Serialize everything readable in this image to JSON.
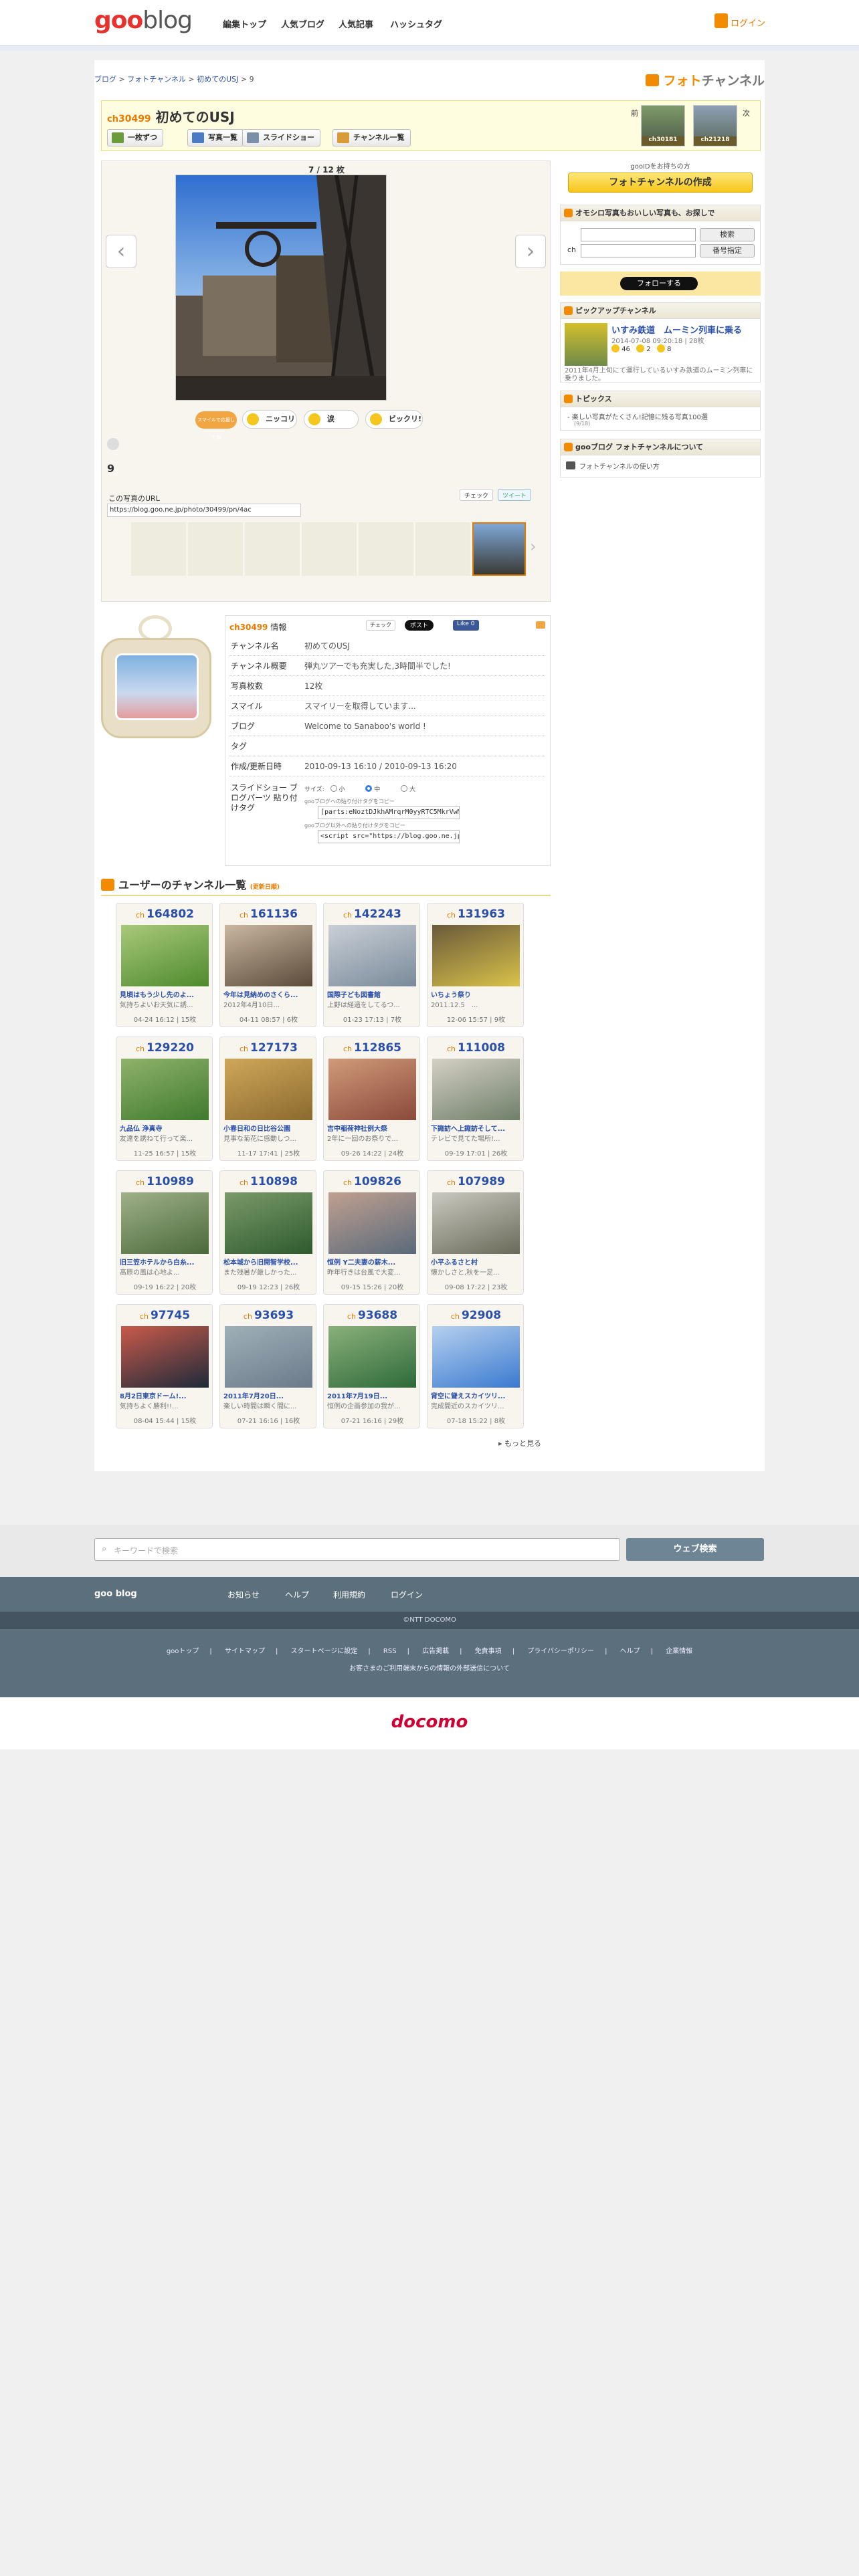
{
  "header": {
    "logo_goo": "goo",
    "logo_blog": "blog",
    "nav": [
      "編集トップ",
      "人気ブログ",
      "人気記事",
      "ハッシュタグ"
    ],
    "login": "ログイン"
  },
  "breadcrumb": {
    "items": [
      "ブログ",
      "フォトチャンネル",
      "初めてのUSJ"
    ],
    "current": "9"
  },
  "photo_channel_logo": {
    "a": "フォト",
    "b": "チャンネル"
  },
  "channel": {
    "prefix": "ch",
    "number": "30499",
    "title": "初めてのUSJ"
  },
  "toolbar": {
    "single": "一枚ずつ",
    "list": "写真一覧",
    "slideshow": "スライドショー",
    "channels": "チャンネル一覧"
  },
  "nav_neighbors": {
    "prev": "前",
    "next": "次",
    "prev_ch": "ch30181",
    "next_ch": "ch21218"
  },
  "viewer": {
    "counter": "7 / 12 枚",
    "caption": "9",
    "url_label": "この写真のURL",
    "url": "https://blog.goo.ne.jp/photo/30499/pn/4ac",
    "reactions": [
      "ニッコリ",
      "涙",
      "ビックリ!"
    ],
    "reaction_hint": "スマイルで応援してね",
    "check": "チェック",
    "tweet": "ツイート"
  },
  "sidebar": {
    "gooid": "gooIDをお持ちの方",
    "create": "フォトチャンネルの作成",
    "search_title": "オモシロ写真もおいしい写真も、お探しで",
    "search_btn": "検索",
    "ch_label": "ch",
    "number_btn": "番号指定",
    "follow": "フォローする",
    "pickup_title": "ピックアップチャンネル",
    "pickup_name": "いすみ鉄道　ムーミン列車に乗る",
    "pickup_date": "2014-07-08 09:20:18 | 28枚",
    "pickup_counts": [
      "46",
      "2",
      "8"
    ],
    "pickup_desc": "2011年4月上旬にて運行しているいすみ鉄道のムーミン列車に乗りました。",
    "topics_title": "トピックス",
    "topics_item": "楽しい写真がたくさん!記憶に残る写真100選",
    "topics_sub": "(9/18)",
    "about_title": "gooブログ フォトチャンネルについて",
    "about_item": "フォトチャンネルの使い方"
  },
  "info": {
    "heading_suffix": "情報",
    "check": "チェック",
    "post": "ポスト",
    "like": "Like 0",
    "rows": [
      {
        "k": "チャンネル名",
        "v": "初めてのUSJ"
      },
      {
        "k": "チャンネル概要",
        "v": "弾丸ツアーでも充実した,3時間半でした!"
      },
      {
        "k": "写真枚数",
        "v": "12枚"
      },
      {
        "k": "スマイル",
        "v": "スマイリーを取得しています..."
      },
      {
        "k": "ブログ",
        "v": "Welcome to Sanaboo's world !"
      },
      {
        "k": "タグ",
        "v": ""
      },
      {
        "k": "作成/更新日時",
        "v": "2010-09-13 16:10 / 2010-09-13 16:20"
      }
    ],
    "slideshow_label": "スライドショー ブログパーツ 貼り付けタグ",
    "size_label": "サイズ:",
    "sizes": [
      "小",
      "中",
      "大"
    ],
    "goo_tag_label": "gooブログへの貼り付けタグをコピー",
    "goo_tag": "[parts:eNoztDJkhAMrqrM0yyRTC5MkrVwMT",
    "ext_tag_label": "gooブログ以外への貼り付けタグをコピー",
    "ext_tag": "<script src=\"https://blog.goo.ne.jp/swf/pic"
  },
  "user_channels": {
    "title": "ユーザーのチャンネル一覧",
    "sub": "(更新日順)",
    "more": "もっと見る",
    "cards": [
      {
        "n": "164802",
        "t": "見頃はもう少し先のよ...",
        "d": "気持ちよいお天気に誘...",
        "m": "04-24 16:12 | 15枚"
      },
      {
        "n": "161136",
        "t": "今年は見納めのさくら...",
        "d": "2012年4月10日...",
        "m": "04-11 08:57 | 6枚"
      },
      {
        "n": "142243",
        "t": "国際子ども図書館",
        "d": "上野は経過をしてるつ...",
        "m": "01-23 17:13 | 7枚"
      },
      {
        "n": "131963",
        "t": "いちょう祭り",
        "d": "2011.12.5　...",
        "m": "12-06 15:57 | 9枚"
      },
      {
        "n": "129220",
        "t": "九品仏 浄真寺",
        "d": "友達を誘ねて行って楽...",
        "m": "11-25 16:57 | 15枚"
      },
      {
        "n": "127173",
        "t": "小春日和の日比谷公園",
        "d": "見事な菊花に感動しつ...",
        "m": "11-17 17:41 | 25枚"
      },
      {
        "n": "112865",
        "t": "吉中稲荷神社例大祭",
        "d": "2年に一回のお祭りで...",
        "m": "09-26 14:22 | 24枚"
      },
      {
        "n": "111008",
        "t": "下諏訪へ上諏訪そして...",
        "d": "テレビで見てた場所!...",
        "m": "09-19 17:01 | 26枚"
      },
      {
        "n": "110989",
        "t": "旧三笠ホテルから白糸...",
        "d": "高原の風は心地よ...",
        "m": "09-19 16:22 | 20枚"
      },
      {
        "n": "110898",
        "t": "松本城から旧開智学校...",
        "d": "また残暑が厳しかった...",
        "m": "09-19 12:23 | 26枚"
      },
      {
        "n": "109826",
        "t": "恒例 Y二夫妻の薪木...",
        "d": "昨年行きは台風で大変...",
        "m": "09-15 15:26 | 20枚"
      },
      {
        "n": "107989",
        "t": "小平ふるさと村",
        "d": "懐かしさと,秋を一足...",
        "m": "09-08 17:22 | 23枚"
      },
      {
        "n": "97745",
        "t": "8月2日東京ドーム!...",
        "d": "気持ちよく勝利!!...",
        "m": "08-04 15:44 | 15枚"
      },
      {
        "n": "93693",
        "t": "2011年7月20日...",
        "d": "楽しい時間は瞬く間に...",
        "m": "07-21 16:16 | 16枚"
      },
      {
        "n": "93688",
        "t": "2011年7月19日...",
        "d": "恒例の企画参加の我が...",
        "m": "07-21 16:16 | 29枚"
      },
      {
        "n": "92908",
        "t": "背空に聳えスカイツリ...",
        "d": "完成間近のスカイツリ...",
        "m": "07-18 15:22 | 8枚"
      }
    ]
  },
  "footer": {
    "search_placeholder": "キーワードで検索",
    "search_btn": "ウェブ検索",
    "brand": "goo blog",
    "links": [
      "お知らせ",
      "ヘルプ",
      "利用規約",
      "ログイン"
    ],
    "copyright": "©NTT DOCOMO",
    "bottom_links": [
      "gooトップ",
      "サイトマップ",
      "スタートページに設定",
      "RSS",
      "広告掲載",
      "免責事項",
      "プライバシーポリシー",
      "ヘルプ",
      "企業情報"
    ],
    "notice": "お客さまのご利用端末からの情報の外部送信について",
    "docomo": "docomo"
  }
}
